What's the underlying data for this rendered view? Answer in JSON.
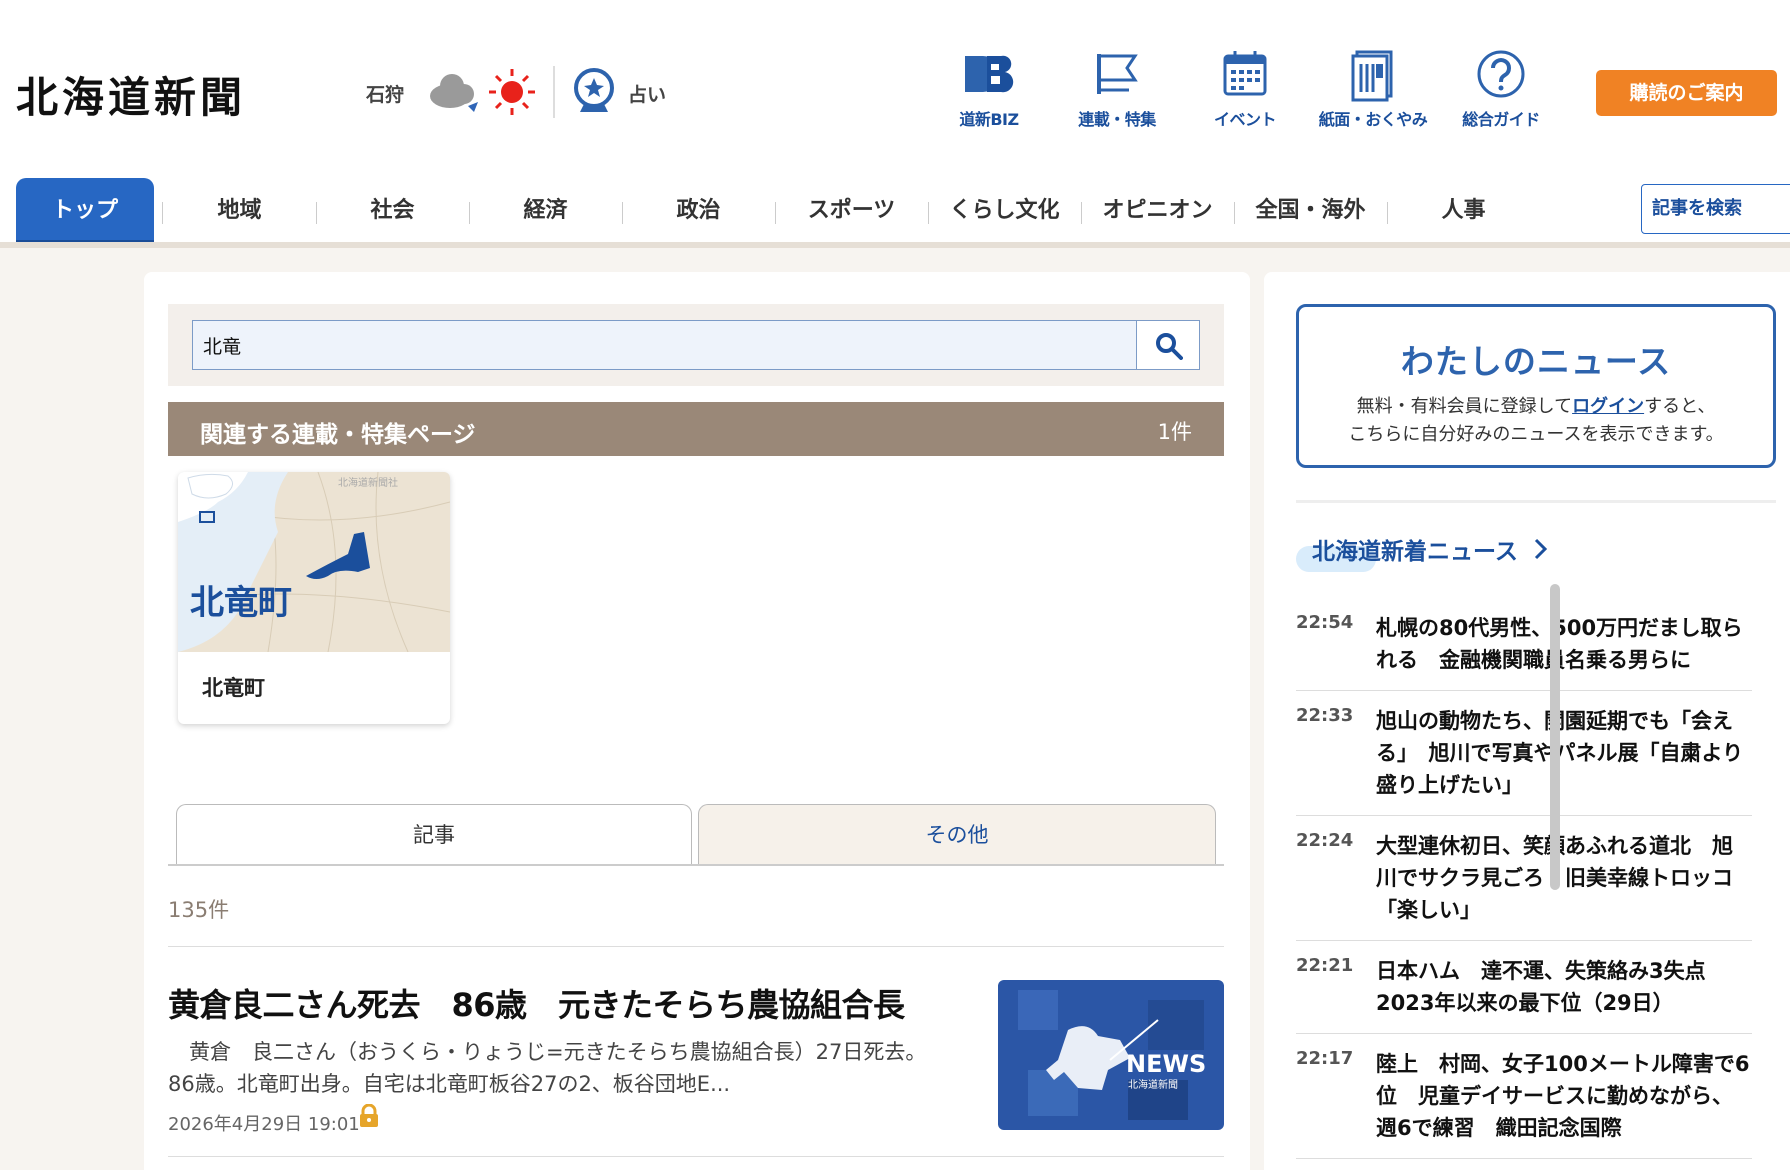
{
  "header": {
    "logo": "北海道新聞",
    "region": "石狩",
    "fortune_label": "占い",
    "nav": [
      {
        "label": "道新BIZ",
        "icon": "doshin-biz-icon"
      },
      {
        "label": "連載・特集",
        "icon": "flag-icon"
      },
      {
        "label": "イベント",
        "icon": "calendar-icon"
      },
      {
        "label": "紙面・おくやみ",
        "icon": "newspaper-icon"
      },
      {
        "label": "総合ガイド",
        "icon": "question-icon"
      }
    ],
    "subscribe_label": "購読のご案内"
  },
  "categories": {
    "items": [
      "トップ",
      "地域",
      "社会",
      "経済",
      "政治",
      "スポーツ",
      "くらし文化",
      "オピニオン",
      "全国・海外",
      "人事"
    ],
    "active": "トップ",
    "search_label": "記事を検索"
  },
  "search": {
    "value": "北竜"
  },
  "series": {
    "heading": "関連する連載・特集ページ",
    "count": "1件",
    "card": {
      "map_credit": "北海道新聞社",
      "map_label": "北竜町",
      "name": "北竜町"
    }
  },
  "tabs": {
    "articles": "記事",
    "other": "その他"
  },
  "results": {
    "count": "135件"
  },
  "article": {
    "title": "黄倉良二さん死去　86歳　元きたそらち農協組合長",
    "summary": "　黄倉　良二さん（おうくら・りょうじ=元きたそらち農協組合長）27日死去。86歳。北竜町出身。自宅は北竜町板谷27の2、板谷団地E...",
    "date": "2026年4月29日 19:01",
    "thumb_text": "NEWS",
    "thumb_sub": "北海道新聞"
  },
  "sidebar": {
    "mynews": {
      "heading": "わたしのニュース",
      "text_before": "無料・有料会員に登録して",
      "login": "ログイン",
      "text_after": "すると、",
      "line2": "こちらに自分好みのニュースを表示できます。"
    },
    "latest_heading": "北海道新着ニュース",
    "news": [
      {
        "time": "22:54",
        "headline": "札幌の80代男性、500万円だまし取られる　金融機関職員名乗る男らに"
      },
      {
        "time": "22:33",
        "headline": "旭山の動物たち、開園延期でも「会える」　旭川で写真やパネル展「自粛より盛り上げたい」"
      },
      {
        "time": "22:24",
        "headline": "大型連休初日、笑顔あふれる道北　旭川でサクラ見ごろ　旧美幸線トロッコ「楽しい」"
      },
      {
        "time": "22:21",
        "headline": "日本ハム　達不運、失策絡み3失点　2023年以来の最下位（29日）"
      },
      {
        "time": "22:17",
        "headline": "陸上　村岡、女子100メートル障害で6位　児童デイサービスに勤めながら、週6で練習　織田記念国際"
      }
    ]
  }
}
